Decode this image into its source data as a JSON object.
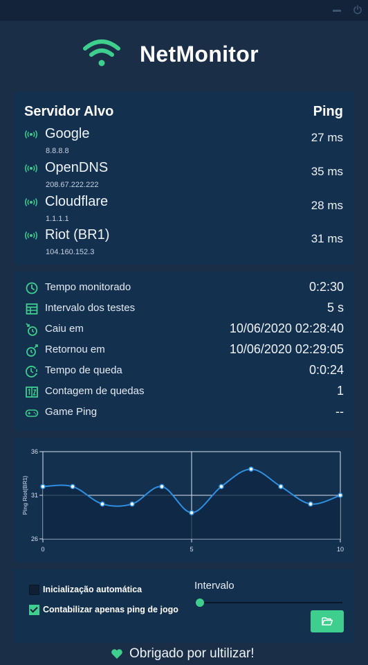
{
  "app": {
    "title": "NetMonitor"
  },
  "colors": {
    "accent": "#3ecf8e",
    "background": "#1a2e48",
    "panel": "#14304f",
    "chart_line": "#2f8fe0"
  },
  "servers": {
    "header_server": "Servidor Alvo",
    "header_ping": "Ping",
    "items": [
      {
        "name": "Google",
        "ip": "8.8.8.8",
        "ping": "27 ms",
        "icon": "signal-icon"
      },
      {
        "name": "OpenDNS",
        "ip": "208.67.222.222",
        "ping": "35 ms",
        "icon": "signal-icon"
      },
      {
        "name": "Cloudflare",
        "ip": "1.1.1.1",
        "ping": "28 ms",
        "icon": "signal-icon"
      },
      {
        "name": "Riot (BR1)",
        "ip": "104.160.152.3",
        "ping": "31 ms",
        "icon": "signal-icon"
      }
    ]
  },
  "stats": [
    {
      "label": "Tempo monitorado",
      "value": "0:2:30",
      "icon": "clock-icon"
    },
    {
      "label": "Intervalo dos testes",
      "value": "5 s",
      "icon": "calendar-table-icon"
    },
    {
      "label": "Caiu em",
      "value": "10/06/2020 02:28:40",
      "icon": "timer-down-icon"
    },
    {
      "label": "Retornou em",
      "value": "10/06/2020 02:29:05",
      "icon": "timer-up-icon"
    },
    {
      "label": "Tempo de queda",
      "value": "0:0:24",
      "icon": "clock-alert-icon"
    },
    {
      "label": "Contagem de quedas",
      "value": "1",
      "icon": "counter-icon"
    },
    {
      "label": "Game Ping",
      "value": "--",
      "icon": "gamepad-icon"
    }
  ],
  "chart_data": {
    "type": "line",
    "ylabel": "Ping Riot(BR1)",
    "xlabel": "",
    "x": [
      0,
      1,
      2,
      3,
      4,
      5,
      6,
      7,
      8,
      9,
      10
    ],
    "series": [
      {
        "values": [
          32,
          32,
          30,
          30,
          32,
          29,
          32,
          34,
          32,
          30,
          31
        ]
      }
    ],
    "xlim": [
      0,
      10
    ],
    "ylim": [
      26,
      36
    ],
    "xticks": [
      "0",
      "5",
      "10"
    ],
    "yticks": [
      "26",
      "31",
      "36"
    ],
    "grid": true,
    "fill": true,
    "smooth": true
  },
  "settings": {
    "autostart_label": "Inicialização automática",
    "autostart_checked": false,
    "game_ping_only_label": "Contabilizar apenas ping de jogo",
    "game_ping_only_checked": true,
    "interval_label": "Intervalo",
    "interval_slider_value": 0,
    "folder_button_icon": "folder-open-icon"
  },
  "footer": {
    "text": "Obrigado por ultilizar!",
    "icon": "heart-icon"
  }
}
